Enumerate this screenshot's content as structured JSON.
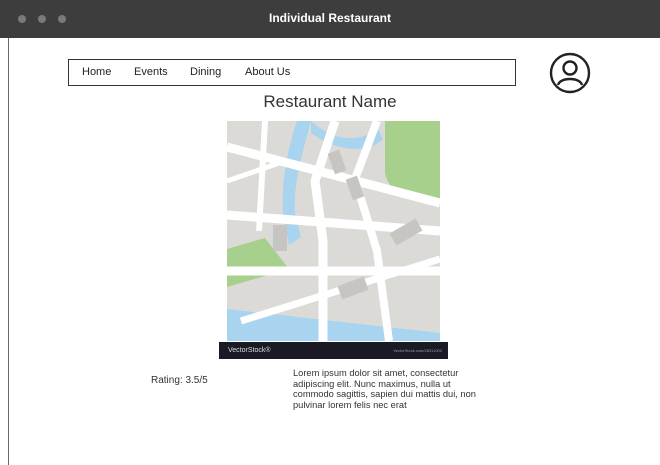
{
  "window": {
    "title": "Individual Restaurant"
  },
  "nav": {
    "items": [
      {
        "label": "Home"
      },
      {
        "label": "Events"
      },
      {
        "label": "Dining"
      },
      {
        "label": "About Us"
      }
    ]
  },
  "profile": {
    "icon": "user-circle-icon"
  },
  "restaurant": {
    "name": "Restaurant Name",
    "rating": "Rating: 3.5/5",
    "description": "Lorem ipsum dolor sit amet, consectetur adipiscing elit. Nunc maximus, nulla ut commodo sagittis, sapien dui mattis dui, non pulvinar lorem felis nec erat"
  },
  "map": {
    "watermark_brand": "VectorStock®",
    "watermark_id": "VectorStock.com/28311000",
    "colors": {
      "road": "#ffffff",
      "block": "#dcdad6",
      "park": "#a8d08d",
      "water": "#a8d4f0"
    }
  }
}
